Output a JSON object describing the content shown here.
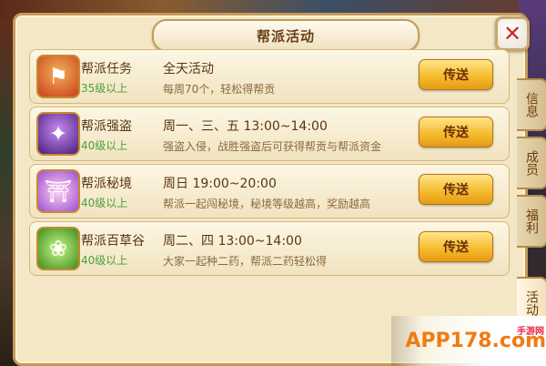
{
  "panel": {
    "title": "帮派活动"
  },
  "close": {
    "glyph": "✕"
  },
  "activities": [
    {
      "icon": "banner-icon",
      "name": "帮派任务",
      "level": "35级以上",
      "time": "全天活动",
      "desc": "每周70个，轻松得帮贡",
      "button": "传送"
    },
    {
      "icon": "thief-icon",
      "name": "帮派强盗",
      "level": "40级以上",
      "time": "周一、三、五 13:00~14:00",
      "desc": "强盗入侵，战胜强盗后可获得帮贡与帮派资金",
      "button": "传送"
    },
    {
      "icon": "pagoda-icon",
      "name": "帮派秘境",
      "level": "40级以上",
      "time": "周日 19:00~20:00",
      "desc": "帮派一起闯秘境，秘境等级越高，奖励越高",
      "button": "传送"
    },
    {
      "icon": "herb-icon",
      "name": "帮派百草谷",
      "level": "40级以上",
      "time": "周二、四 13:00~14:00",
      "desc": "大家一起种二药，帮派二药轻松得",
      "button": "传送"
    }
  ],
  "side_tabs": [
    "信息",
    "成员",
    "福利",
    "活动"
  ],
  "watermark": {
    "text": "APP178.com",
    "sub": "手游网"
  }
}
